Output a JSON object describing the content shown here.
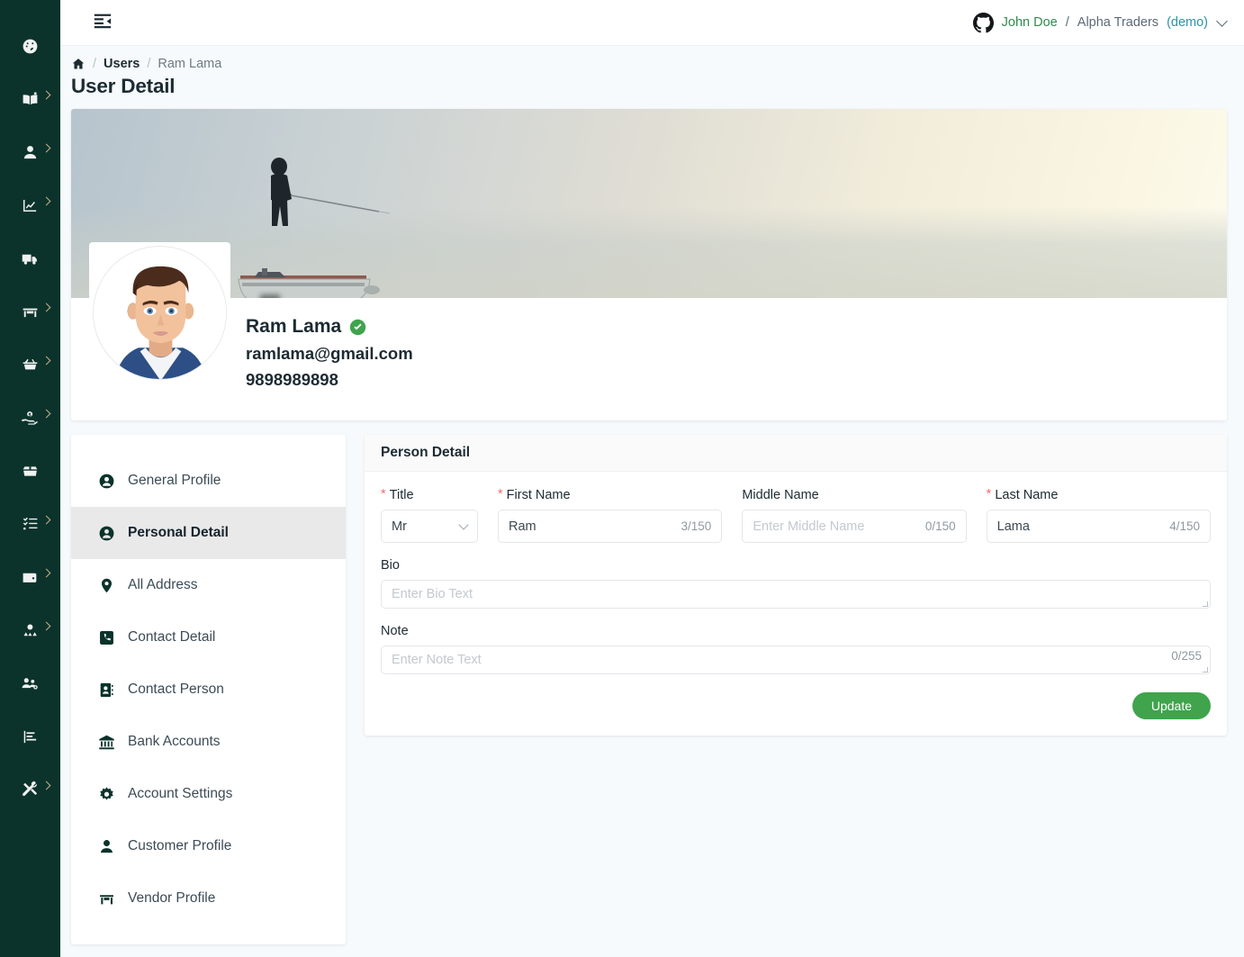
{
  "theme": {
    "rail_bg": "#0b332b",
    "page_bg": "#f7fafc",
    "accent_green": "#3fa44c",
    "user_name_green": "#2f8c4e",
    "demo_teal": "#2a94a8",
    "required_red": "#f26b6b"
  },
  "rail": {
    "items": [
      {
        "name": "dashboard",
        "icon": "dashboard-icon",
        "has_caret": false
      },
      {
        "name": "catalog",
        "icon": "book-open-icon",
        "has_caret": true
      },
      {
        "name": "users",
        "icon": "user-icon",
        "has_caret": true
      },
      {
        "name": "reports",
        "icon": "chart-line-icon",
        "has_caret": true
      },
      {
        "name": "shipping",
        "icon": "truck-icon",
        "has_caret": false
      },
      {
        "name": "store",
        "icon": "store-icon",
        "has_caret": true
      },
      {
        "name": "purchase",
        "icon": "basket-icon",
        "has_caret": true
      },
      {
        "name": "payments",
        "icon": "hand-money-icon",
        "has_caret": true
      },
      {
        "name": "inventory",
        "icon": "open-box-icon",
        "has_caret": false
      },
      {
        "name": "tasks",
        "icon": "checklist-icon",
        "has_caret": true
      },
      {
        "name": "wallet",
        "icon": "wallet-icon",
        "has_caret": true
      },
      {
        "name": "customers",
        "icon": "people-group-icon",
        "has_caret": true
      },
      {
        "name": "team-settings",
        "icon": "users-cog-icon",
        "has_caret": false
      },
      {
        "name": "analytics",
        "icon": "bar-chart-icon",
        "has_caret": false
      },
      {
        "name": "tools",
        "icon": "tools-icon",
        "has_caret": true
      }
    ]
  },
  "topbar": {
    "menu_fold_icon": "menu-fold-icon",
    "account": {
      "provider_icon": "github-icon",
      "user": "John Doe",
      "separator": "/",
      "org": "Alpha Traders",
      "env": "(demo)"
    }
  },
  "breadcrumb": {
    "home_icon": "home-icon",
    "items": [
      {
        "label": "Users",
        "current": false
      },
      {
        "label": "Ram Lama",
        "current": true
      }
    ],
    "separator": "/"
  },
  "page_title": "User Detail",
  "profile": {
    "cover_alt": "fisherman-on-boat-cover",
    "avatar_alt": "user-avatar",
    "name": "Ram Lama",
    "verified": true,
    "email": "ramlama@gmail.com",
    "phone": "9898989898"
  },
  "nav": {
    "items": [
      {
        "label": "General Profile",
        "icon": "user-circle-icon",
        "active": false
      },
      {
        "label": "Personal Detail",
        "icon": "user-circle-icon",
        "active": true
      },
      {
        "label": "All Address",
        "icon": "map-pin-icon",
        "active": false
      },
      {
        "label": "Contact Detail",
        "icon": "phone-square-icon",
        "active": false
      },
      {
        "label": "Contact Person",
        "icon": "address-book-icon",
        "active": false
      },
      {
        "label": "Bank Accounts",
        "icon": "bank-icon",
        "active": false
      },
      {
        "label": "Account Settings",
        "icon": "gear-icon",
        "active": false
      },
      {
        "label": "Customer Profile",
        "icon": "person-icon",
        "active": false
      },
      {
        "label": "Vendor Profile",
        "icon": "store-icon",
        "active": false
      }
    ]
  },
  "form": {
    "heading": "Person Detail",
    "fields": {
      "title": {
        "label": "Title",
        "required": true,
        "value": "Mr",
        "caret_icon": "chevron-down-icon"
      },
      "first_name": {
        "label": "First Name",
        "required": true,
        "value": "Ram",
        "counter": "3/150"
      },
      "middle_name": {
        "label": "Middle Name",
        "required": false,
        "value": "",
        "placeholder": "Enter Middle Name",
        "counter": "0/150"
      },
      "last_name": {
        "label": "Last Name",
        "required": true,
        "value": "Lama",
        "counter": "4/150"
      },
      "bio": {
        "label": "Bio",
        "value": "",
        "placeholder": "Enter Bio Text"
      },
      "note": {
        "label": "Note",
        "value": "",
        "placeholder": "Enter Note Text",
        "counter": "0/255"
      }
    },
    "submit_label": "Update"
  }
}
